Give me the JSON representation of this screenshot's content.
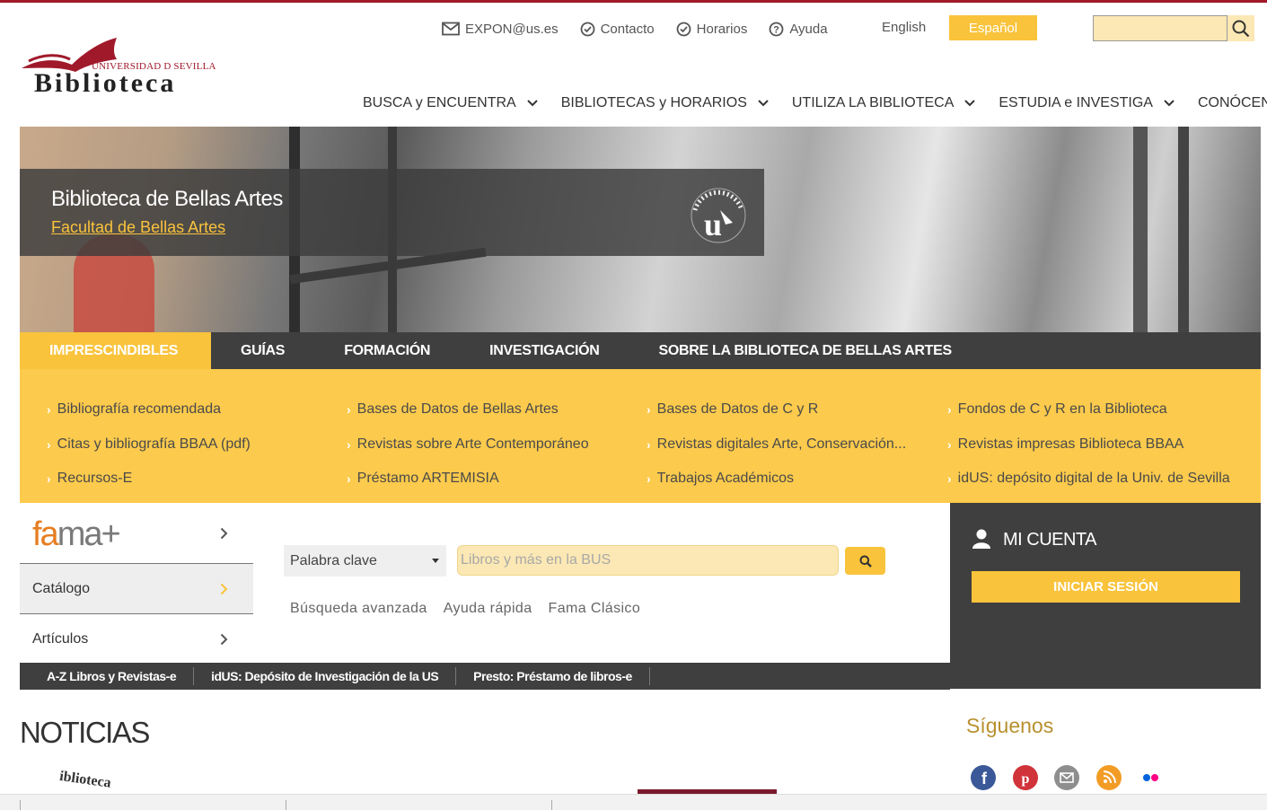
{
  "header": {
    "logo_university": "UNIVERSIDAD D SEVILLA",
    "logo_title": "Biblioteca",
    "top_links": [
      {
        "label": "EXPON@us.es",
        "icon": "mail-icon"
      },
      {
        "label": "Contacto",
        "icon": "check-circle-icon"
      },
      {
        "label": "Horarios",
        "icon": "check-circle-icon"
      },
      {
        "label": "Ayuda",
        "icon": "help-circle-icon"
      }
    ],
    "lang_english": "English",
    "lang_spanish": "Español",
    "search_placeholder": ""
  },
  "mainnav": [
    "BUSCA y ENCUENTRA",
    "BIBLIOTECAS y HORARIOS",
    "UTILIZA LA BIBLIOTECA",
    "ESTUDIA e INVESTIGA",
    "CONÓCENOS"
  ],
  "hero": {
    "title": "Biblioteca de Bellas Artes",
    "subtitle": "Facultad de Bellas Artes"
  },
  "tabs": [
    "IMPRESCINDIBLES",
    "GUÍAS",
    "FORMACIÓN",
    "INVESTIGACIÓN",
    "SOBRE LA BIBLIOTECA DE BELLAS ARTES"
  ],
  "quicklinks": {
    "col1": [
      "Bibliografía recomendada",
      "Citas y bibliografía BBAA (pdf)",
      "Recursos-E"
    ],
    "col2": [
      "Bases de Datos de Bellas Artes",
      "Revistas sobre Arte Contemporáneo",
      "Préstamo ARTEMISIA"
    ],
    "col3": [
      "Bases de Datos de C y R",
      "Revistas digitales Arte, Conservación...",
      "Trabajos Académicos"
    ],
    "col4": [
      "Fondos de C y R en la Biblioteca",
      "Revistas impresas Biblioteca BBAA",
      "idUS: depósito digital de la Univ. de Sevilla"
    ]
  },
  "sidebar": {
    "fama_logo": "fama+",
    "items": [
      "Catálogo",
      "Artículos"
    ]
  },
  "search": {
    "select_value": "Palabra clave",
    "input_placeholder": "Libros y más en la BUS",
    "links": [
      "Búsqueda avanzada",
      "Ayuda rápida",
      "Fama Clásico"
    ]
  },
  "account": {
    "title": "MI CUENTA",
    "login_button": "INICIAR SESIÓN"
  },
  "quickbar": [
    "A-Z Libros y Revistas-e",
    "idUS: Depósito de Investigación de la US",
    "Presto: Préstamo de libros-e"
  ],
  "news": {
    "title": "NOTICIAS",
    "thumb1_text": "iblioteca"
  },
  "follow": {
    "title": "Síguenos",
    "icons": [
      "facebook-icon",
      "pinterest-icon",
      "email-icon",
      "rss-icon",
      "flickr-icon"
    ]
  },
  "colors": {
    "brand_red": "#a0192b",
    "accent_yellow": "#f9c33b",
    "dark_gray": "#3f3f3f"
  }
}
